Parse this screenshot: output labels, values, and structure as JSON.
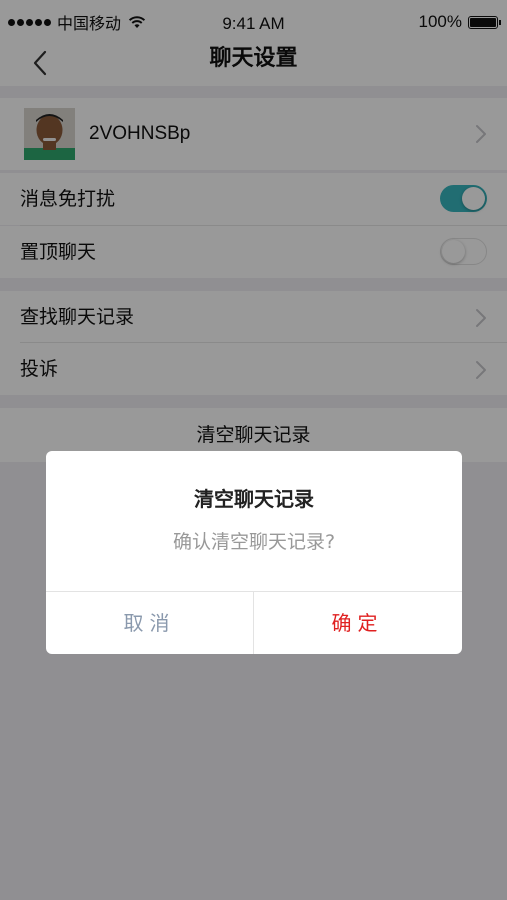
{
  "status_bar": {
    "carrier": "中国移动",
    "time": "9:41 AM",
    "battery_text": "100%"
  },
  "nav": {
    "title": "聊天设置",
    "back_icon": "chevron-left-icon"
  },
  "profile": {
    "name": "2VOHNSBp",
    "avatar_icon": "user-avatar"
  },
  "settings": {
    "mute_label": "消息免打扰",
    "mute_on": true,
    "pin_label": "置顶聊天",
    "pin_on": false,
    "search_history_label": "查找聊天记录",
    "report_label": "投诉",
    "clear_label": "清空聊天记录"
  },
  "dialog": {
    "title": "清空聊天记录",
    "message": "确认清空聊天记录?",
    "cancel_label": "取消",
    "confirm_label": "确定"
  },
  "colors": {
    "toggle_on": "#37b6bf",
    "confirm_text": "#e02020",
    "cancel_text": "#8a99ad"
  }
}
